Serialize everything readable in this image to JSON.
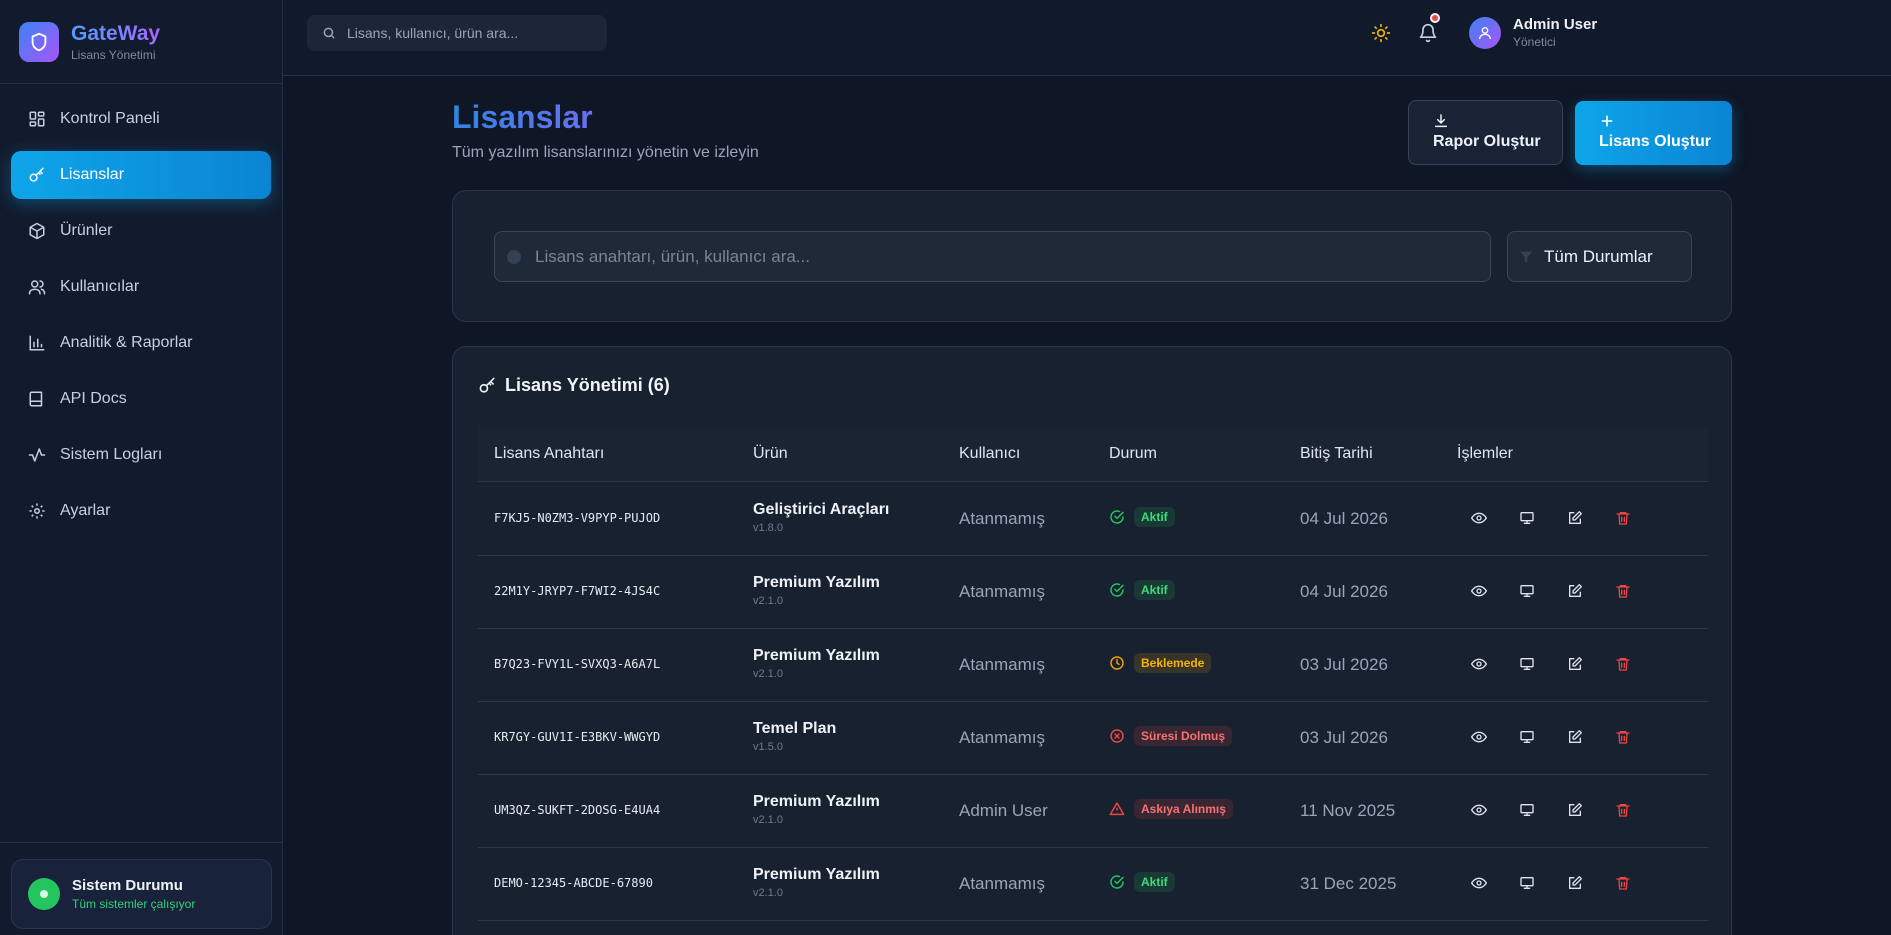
{
  "brand": {
    "name": "GateWay",
    "subtitle": "Lisans Yönetimi"
  },
  "sidebar": {
    "items": [
      {
        "label": "Kontrol Paneli",
        "icon": "grid-icon",
        "active": false
      },
      {
        "label": "Lisanslar",
        "icon": "key-icon",
        "active": true
      },
      {
        "label": "Ürünler",
        "icon": "package-icon",
        "active": false
      },
      {
        "label": "Kullanıcılar",
        "icon": "users-icon",
        "active": false
      },
      {
        "label": "Analitik & Raporlar",
        "icon": "bar-chart-icon",
        "active": false
      },
      {
        "label": "API Docs",
        "icon": "book-icon",
        "active": false
      },
      {
        "label": "Sistem Logları",
        "icon": "activity-icon",
        "active": false
      },
      {
        "label": "Ayarlar",
        "icon": "gear-icon",
        "active": false
      }
    ],
    "system_status": {
      "title": "Sistem Durumu",
      "subtitle": "Tüm sistemler çalışıyor"
    }
  },
  "topbar": {
    "search_placeholder": "Lisans, kullanıcı, ürün ara...",
    "user": {
      "name": "Admin User",
      "role": "Yönetici"
    }
  },
  "page": {
    "title": "Lisanslar",
    "subtitle": "Tüm yazılım lisanslarınızı yönetin ve izleyin",
    "report_button": "Rapor Oluştur",
    "create_button": "Lisans Oluştur"
  },
  "filters": {
    "search_placeholder": "Lisans anahtarı, ürün, kullanıcı ara...",
    "status_select": "Tüm Durumlar"
  },
  "table": {
    "title": "Lisans Yönetimi (6)",
    "columns": [
      "Lisans Anahtarı",
      "Ürün",
      "Kullanıcı",
      "Durum",
      "Bitiş Tarihi",
      "İşlemler"
    ],
    "rows": [
      {
        "key": "F7KJ5-N0ZM3-V9PYP-PUJOD",
        "product": "Geliştirici Araçları",
        "version": "v1.8.0",
        "user": "Atanmamış",
        "status": "Aktif",
        "status_type": "active",
        "expiry": "04 Jul 2026"
      },
      {
        "key": "22M1Y-JRYP7-F7WI2-4JS4C",
        "product": "Premium Yazılım",
        "version": "v2.1.0",
        "user": "Atanmamış",
        "status": "Aktif",
        "status_type": "active",
        "expiry": "04 Jul 2026"
      },
      {
        "key": "B7Q23-FVY1L-SVXQ3-A6A7L",
        "product": "Premium Yazılım",
        "version": "v2.1.0",
        "user": "Atanmamış",
        "status": "Beklemede",
        "status_type": "pending",
        "expiry": "03 Jul 2026"
      },
      {
        "key": "KR7GY-GUV1I-E3BKV-WWGYD",
        "product": "Temel Plan",
        "version": "v1.5.0",
        "user": "Atanmamış",
        "status": "Süresi Dolmuş",
        "status_type": "expired",
        "expiry": "03 Jul 2026"
      },
      {
        "key": "UM3QZ-SUKFT-2DOSG-E4UA4",
        "product": "Premium Yazılım",
        "version": "v2.1.0",
        "user": "Admin User",
        "status": "Askıya Alınmış",
        "status_type": "suspended",
        "expiry": "11 Nov 2025"
      },
      {
        "key": "DEMO-12345-ABCDE-67890",
        "product": "Premium Yazılım",
        "version": "v2.1.0",
        "user": "Atanmamış",
        "status": "Aktif",
        "status_type": "active",
        "expiry": "31 Dec 2025"
      }
    ]
  },
  "colors": {
    "accent": "#0ea5e9",
    "active": "#22c55e",
    "pending": "#f59e0b",
    "expired": "#ef4444",
    "suspended": "#ef4444"
  }
}
